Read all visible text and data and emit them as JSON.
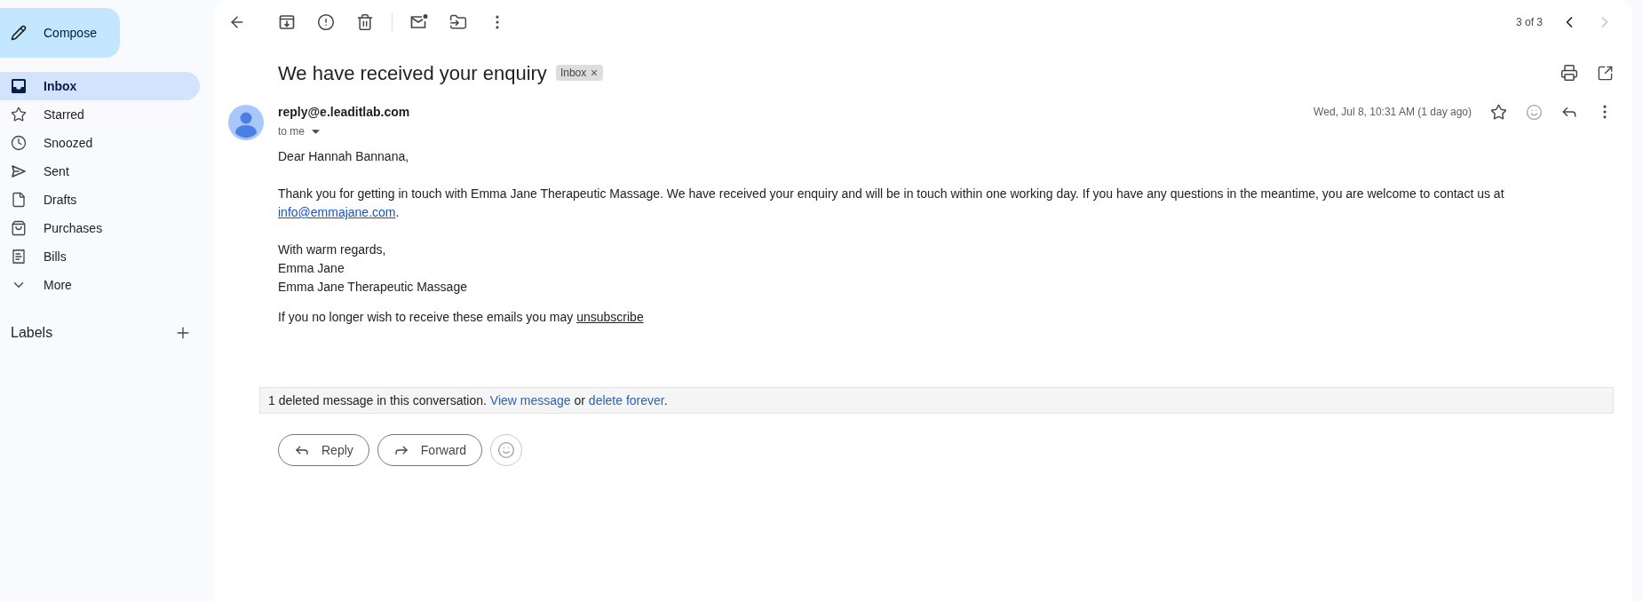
{
  "sidebar": {
    "compose": "Compose",
    "items": [
      {
        "label": "Inbox",
        "selected": true
      },
      {
        "label": "Starred",
        "selected": false
      },
      {
        "label": "Snoozed",
        "selected": false
      },
      {
        "label": "Sent",
        "selected": false
      },
      {
        "label": "Drafts",
        "selected": false
      },
      {
        "label": "Purchases",
        "selected": false
      },
      {
        "label": "Bills",
        "selected": false
      },
      {
        "label": "More",
        "selected": false
      }
    ],
    "labels_heading": "Labels"
  },
  "toolbar": {
    "position": "3 of 3",
    "previous_disabled": false,
    "next_disabled": true
  },
  "message": {
    "subject": "We have received your enquiry",
    "label_chip": "Inbox",
    "sender": "reply@e.leaditlab.com",
    "recipient": "to me",
    "date": "Wed, Jul 8, 10:31 AM (1 day ago)"
  },
  "body": {
    "greeting": "Dear Hannah Bannana,",
    "paragraph": {
      "text": "Thank you for getting in touch with Emma Jane Therapeutic Massage. We have received your enquiry and will be in touch within one working day. If you have any questions in the meantime, you are welcome to contact us at",
      "link": "info@emmajane.com",
      "end": "."
    },
    "closing": "With warm regards,",
    "signature_name": "Emma Jane",
    "signature_company": "Emma Jane Therapeutic Massage",
    "footer": {
      "text": "If you no longer wish to receive these emails you may",
      "link": "unsubscribe"
    }
  },
  "deleted_notice": {
    "text": "1 deleted message in this conversation.",
    "view_link": "View message",
    "joiner": "or",
    "delete_link": "delete forever",
    "end": "."
  },
  "actions": [
    {
      "label": "Reply"
    },
    {
      "label": "Forward"
    }
  ]
}
